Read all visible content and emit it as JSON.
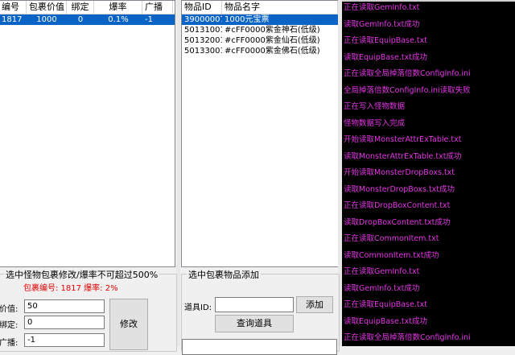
{
  "packages": {
    "columns": [
      "编号",
      "包裹价值",
      "绑定",
      "爆率",
      "广播"
    ],
    "rows": [
      {
        "id": "1817",
        "value": "1000",
        "bind": "0",
        "rate": "0.1%",
        "broadcast": "-1",
        "selected": true
      }
    ]
  },
  "items": {
    "columns": [
      "物品ID",
      "物品名字"
    ],
    "rows": [
      {
        "id": "39000007",
        "name": "1000元宝票",
        "selected": true
      },
      {
        "id": "50131001",
        "name": "#cFF0000紫金神石(低级)",
        "selected": false
      },
      {
        "id": "50132001",
        "name": "#cFF0000紫金仙石(低级)",
        "selected": false
      },
      {
        "id": "50133001",
        "name": "#cFF0000紫金佛石(低级)",
        "selected": false
      }
    ]
  },
  "edit_panel": {
    "title": "选中怪物包裹修改/爆率不可超过500%",
    "info": "包裹编号: 1817  爆率: 2%",
    "value_label": "价值:",
    "value": "50",
    "bind_label": "绑定:",
    "bind": "0",
    "broadcast_label": "广播:",
    "broadcast": "-1",
    "modify_button": "修改"
  },
  "add_panel": {
    "title": "选中包裹物品添加",
    "item_id_label": "道具ID:",
    "item_id": "",
    "add_button": "添加",
    "query_button": "查询道具"
  },
  "log": {
    "lines": [
      "正在读取GemInfo.txt",
      "读取GemInfo.txt成功",
      "正在读取EquipBase.txt",
      "读取EquipBase.txt成功",
      "正在读取全局掉落倍数ConfigInfo.ini",
      "全局掉落倍数ConfigInfo.ini读取失败",
      "正在写入怪物数据",
      "怪物数据写入完成",
      "开始读取MonsterAttrExTable.txt",
      "读取MonsterAttrExTable.txt成功",
      "开始读取MonsterDropBoxs.txt",
      "读取MonsterDropBoxs.txt成功",
      "正在读取DropBoxContent.txt",
      "读取DropBoxContent.txt成功",
      "正在读取CommonItem.txt",
      "读取CommonItem.txt成功",
      "正在读取GemInfo.txt",
      "读取GemInfo.txt成功",
      "正在读取EquipBase.txt",
      "读取EquipBase.txt成功",
      "正在读取全局掉落倍数ConfigInfo.ini"
    ],
    "color": "#e535e5"
  },
  "colors": {
    "selection": "#0a64c6",
    "error": "#e00000"
  }
}
